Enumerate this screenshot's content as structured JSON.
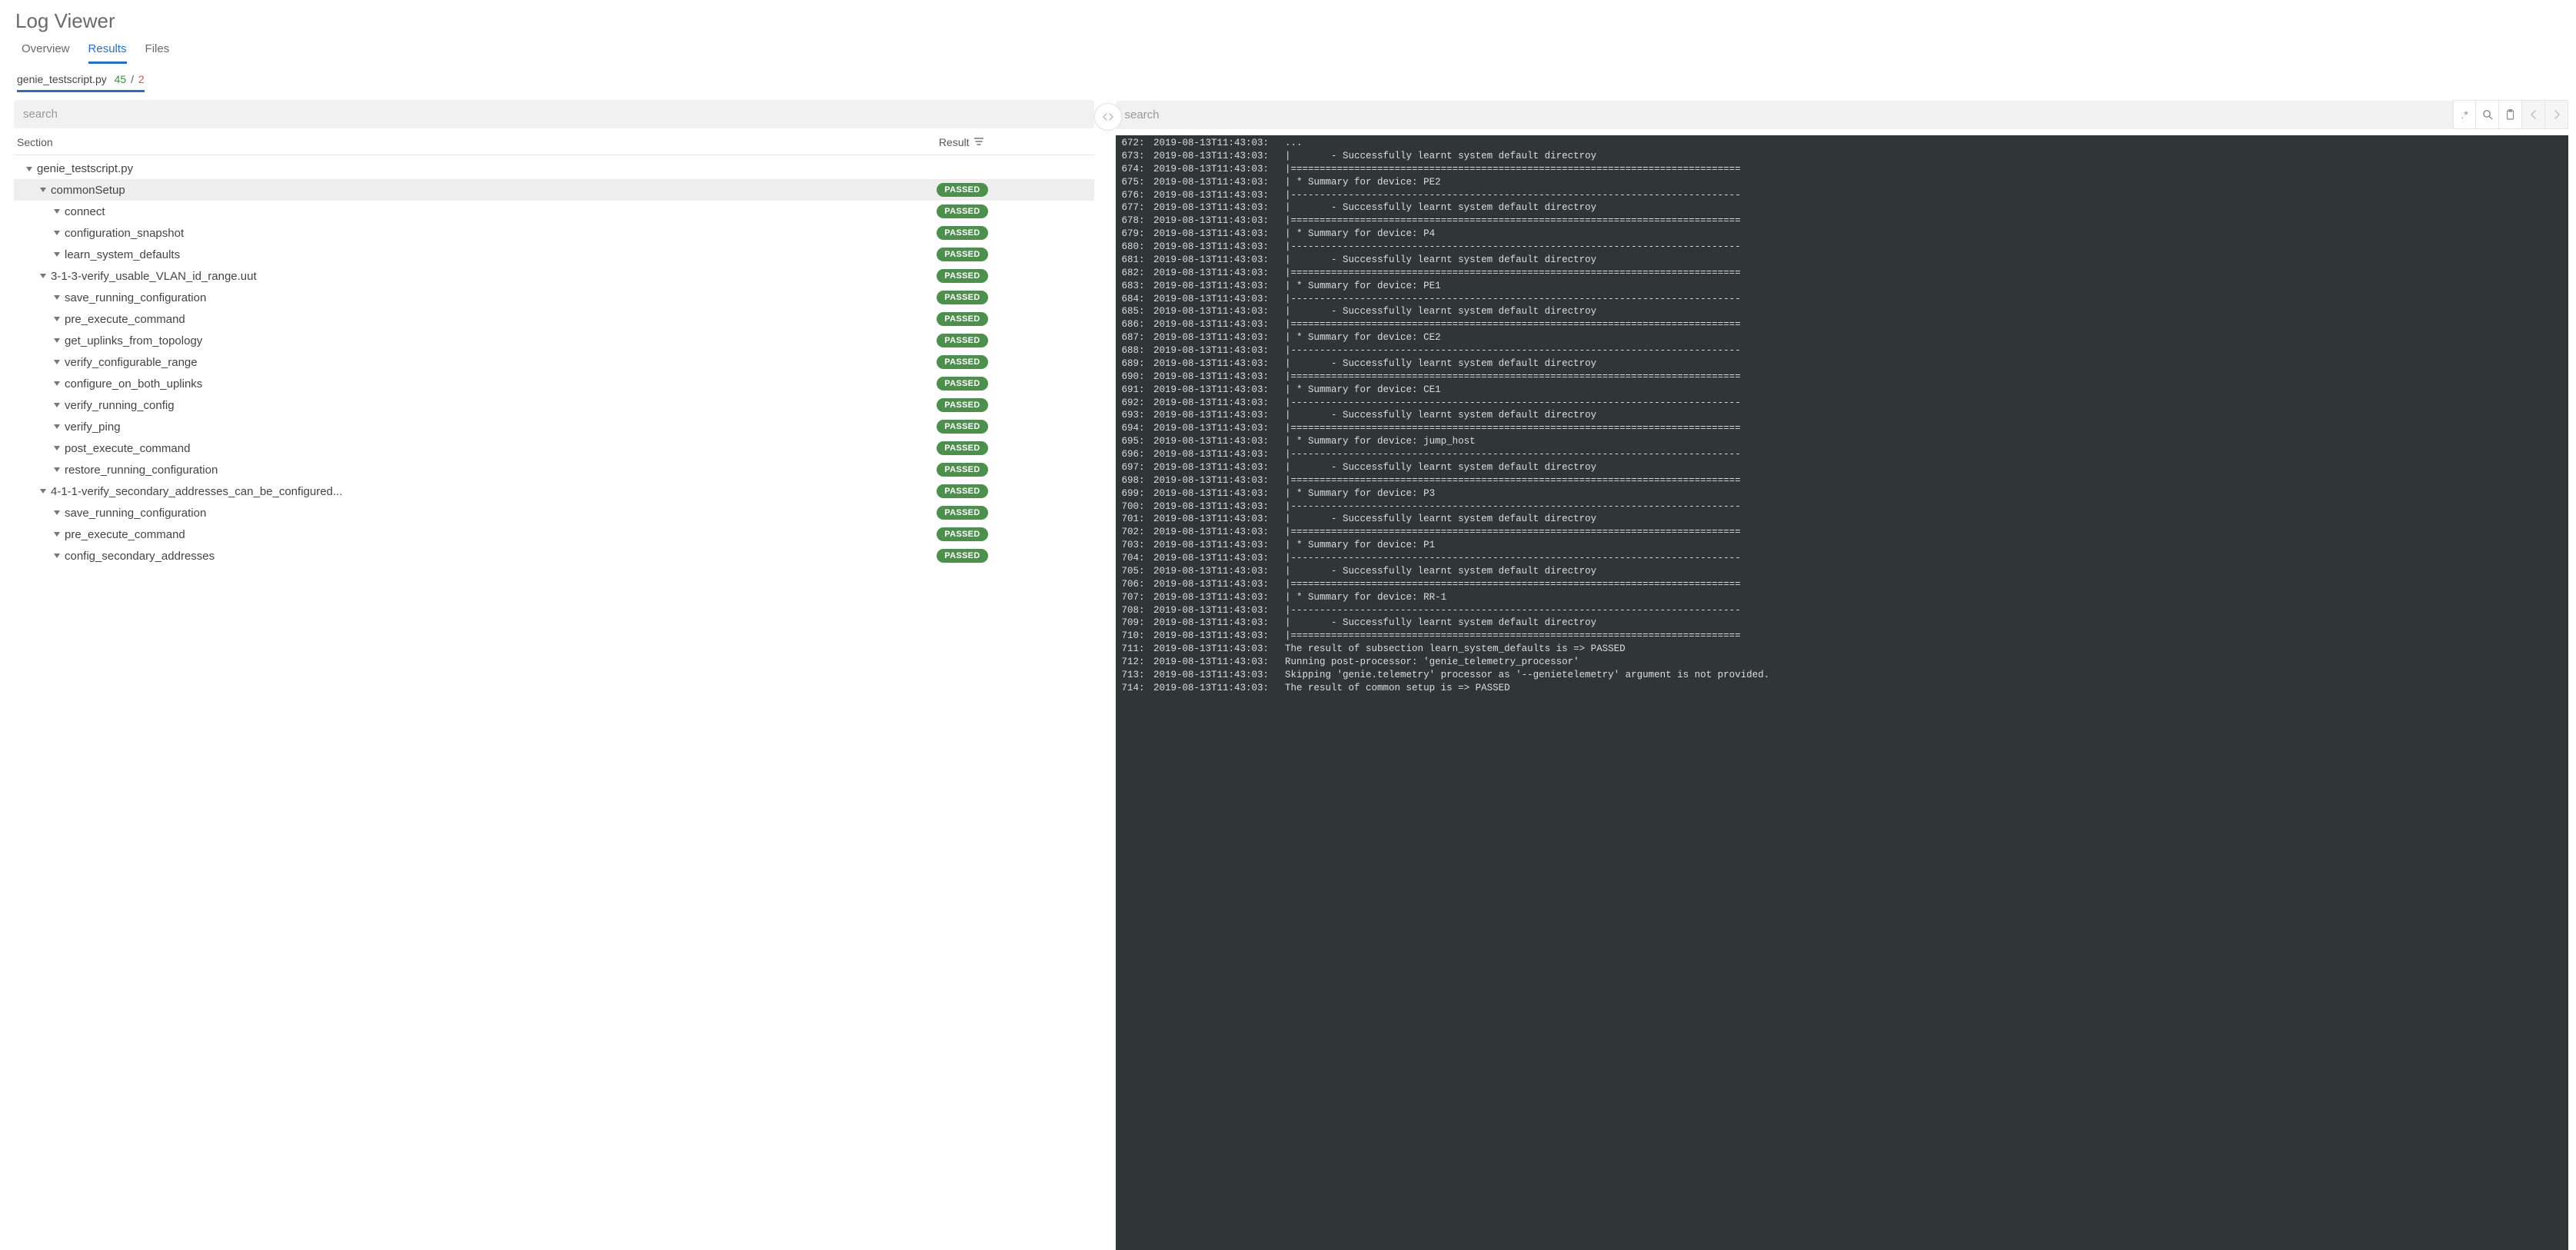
{
  "title": "Log Viewer",
  "tabs": [
    "Overview",
    "Results",
    "Files"
  ],
  "active_tab": 1,
  "subtab": {
    "label": "genie_testscript.py",
    "pass": "45",
    "sep": "/",
    "fail": "2"
  },
  "columns": {
    "section": "Section",
    "result": "Result"
  },
  "search_placeholder": "search",
  "toolbar": {
    "regex": ".*",
    "search_icon": "search",
    "copy_icon": "clipboard",
    "prev": "‹",
    "next": "›"
  },
  "tree": [
    {
      "indent": 0,
      "label": "genie_testscript.py",
      "badge": "",
      "selected": false
    },
    {
      "indent": 1,
      "label": "commonSetup",
      "badge": "PASSED",
      "selected": true
    },
    {
      "indent": 2,
      "label": "connect",
      "badge": "PASSED"
    },
    {
      "indent": 2,
      "label": "configuration_snapshot",
      "badge": "PASSED"
    },
    {
      "indent": 2,
      "label": "learn_system_defaults",
      "badge": "PASSED"
    },
    {
      "indent": 1,
      "label": "3-1-3-verify_usable_VLAN_id_range.uut",
      "badge": "PASSED"
    },
    {
      "indent": 2,
      "label": "save_running_configuration",
      "badge": "PASSED"
    },
    {
      "indent": 2,
      "label": "pre_execute_command",
      "badge": "PASSED"
    },
    {
      "indent": 2,
      "label": "get_uplinks_from_topology",
      "badge": "PASSED"
    },
    {
      "indent": 2,
      "label": "verify_configurable_range",
      "badge": "PASSED"
    },
    {
      "indent": 2,
      "label": "configure_on_both_uplinks",
      "badge": "PASSED"
    },
    {
      "indent": 2,
      "label": "verify_running_config",
      "badge": "PASSED"
    },
    {
      "indent": 2,
      "label": "verify_ping",
      "badge": "PASSED"
    },
    {
      "indent": 2,
      "label": "post_execute_command",
      "badge": "PASSED"
    },
    {
      "indent": 2,
      "label": "restore_running_configuration",
      "badge": "PASSED"
    },
    {
      "indent": 1,
      "label": "4-1-1-verify_secondary_addresses_can_be_configured...",
      "badge": "PASSED"
    },
    {
      "indent": 2,
      "label": "save_running_configuration",
      "badge": "PASSED"
    },
    {
      "indent": 2,
      "label": "pre_execute_command",
      "badge": "PASSED"
    },
    {
      "indent": 2,
      "label": "config_secondary_addresses",
      "badge": "PASSED"
    }
  ],
  "log": {
    "ts": "2019-08-13T11:43:03:",
    "lines": [
      {
        "n": 672,
        "t": "..."
      },
      {
        "n": 673,
        "t": "|       - Successfully learnt system default directroy"
      },
      {
        "n": 674,
        "t": "|=============================================================================="
      },
      {
        "n": 675,
        "t": "| * Summary for device: PE2"
      },
      {
        "n": 676,
        "t": "|------------------------------------------------------------------------------"
      },
      {
        "n": 677,
        "t": "|       - Successfully learnt system default directroy"
      },
      {
        "n": 678,
        "t": "|=============================================================================="
      },
      {
        "n": 679,
        "t": "| * Summary for device: P4"
      },
      {
        "n": 680,
        "t": "|------------------------------------------------------------------------------"
      },
      {
        "n": 681,
        "t": "|       - Successfully learnt system default directroy"
      },
      {
        "n": 682,
        "t": "|=============================================================================="
      },
      {
        "n": 683,
        "t": "| * Summary for device: PE1"
      },
      {
        "n": 684,
        "t": "|------------------------------------------------------------------------------"
      },
      {
        "n": 685,
        "t": "|       - Successfully learnt system default directroy"
      },
      {
        "n": 686,
        "t": "|=============================================================================="
      },
      {
        "n": 687,
        "t": "| * Summary for device: CE2"
      },
      {
        "n": 688,
        "t": "|------------------------------------------------------------------------------"
      },
      {
        "n": 689,
        "t": "|       - Successfully learnt system default directroy"
      },
      {
        "n": 690,
        "t": "|=============================================================================="
      },
      {
        "n": 691,
        "t": "| * Summary for device: CE1"
      },
      {
        "n": 692,
        "t": "|------------------------------------------------------------------------------"
      },
      {
        "n": 693,
        "t": "|       - Successfully learnt system default directroy"
      },
      {
        "n": 694,
        "t": "|=============================================================================="
      },
      {
        "n": 695,
        "t": "| * Summary for device: jump_host"
      },
      {
        "n": 696,
        "t": "|------------------------------------------------------------------------------"
      },
      {
        "n": 697,
        "t": "|       - Successfully learnt system default directroy"
      },
      {
        "n": 698,
        "t": "|=============================================================================="
      },
      {
        "n": 699,
        "t": "| * Summary for device: P3"
      },
      {
        "n": 700,
        "t": "|------------------------------------------------------------------------------"
      },
      {
        "n": 701,
        "t": "|       - Successfully learnt system default directroy"
      },
      {
        "n": 702,
        "t": "|=============================================================================="
      },
      {
        "n": 703,
        "t": "| * Summary for device: P1"
      },
      {
        "n": 704,
        "t": "|------------------------------------------------------------------------------"
      },
      {
        "n": 705,
        "t": "|       - Successfully learnt system default directroy"
      },
      {
        "n": 706,
        "t": "|=============================================================================="
      },
      {
        "n": 707,
        "t": "| * Summary for device: RR-1"
      },
      {
        "n": 708,
        "t": "|------------------------------------------------------------------------------"
      },
      {
        "n": 709,
        "t": "|       - Successfully learnt system default directroy"
      },
      {
        "n": 710,
        "t": "|=============================================================================="
      },
      {
        "n": 711,
        "t": "The result of subsection learn_system_defaults is => PASSED"
      },
      {
        "n": 712,
        "t": "Running post-processor: 'genie_telemetry_processor'"
      },
      {
        "n": 713,
        "t": "Skipping 'genie.telemetry' processor as '--genietelemetry' argument is not provided."
      },
      {
        "n": 714,
        "t": "The result of common setup is => PASSED"
      }
    ]
  }
}
